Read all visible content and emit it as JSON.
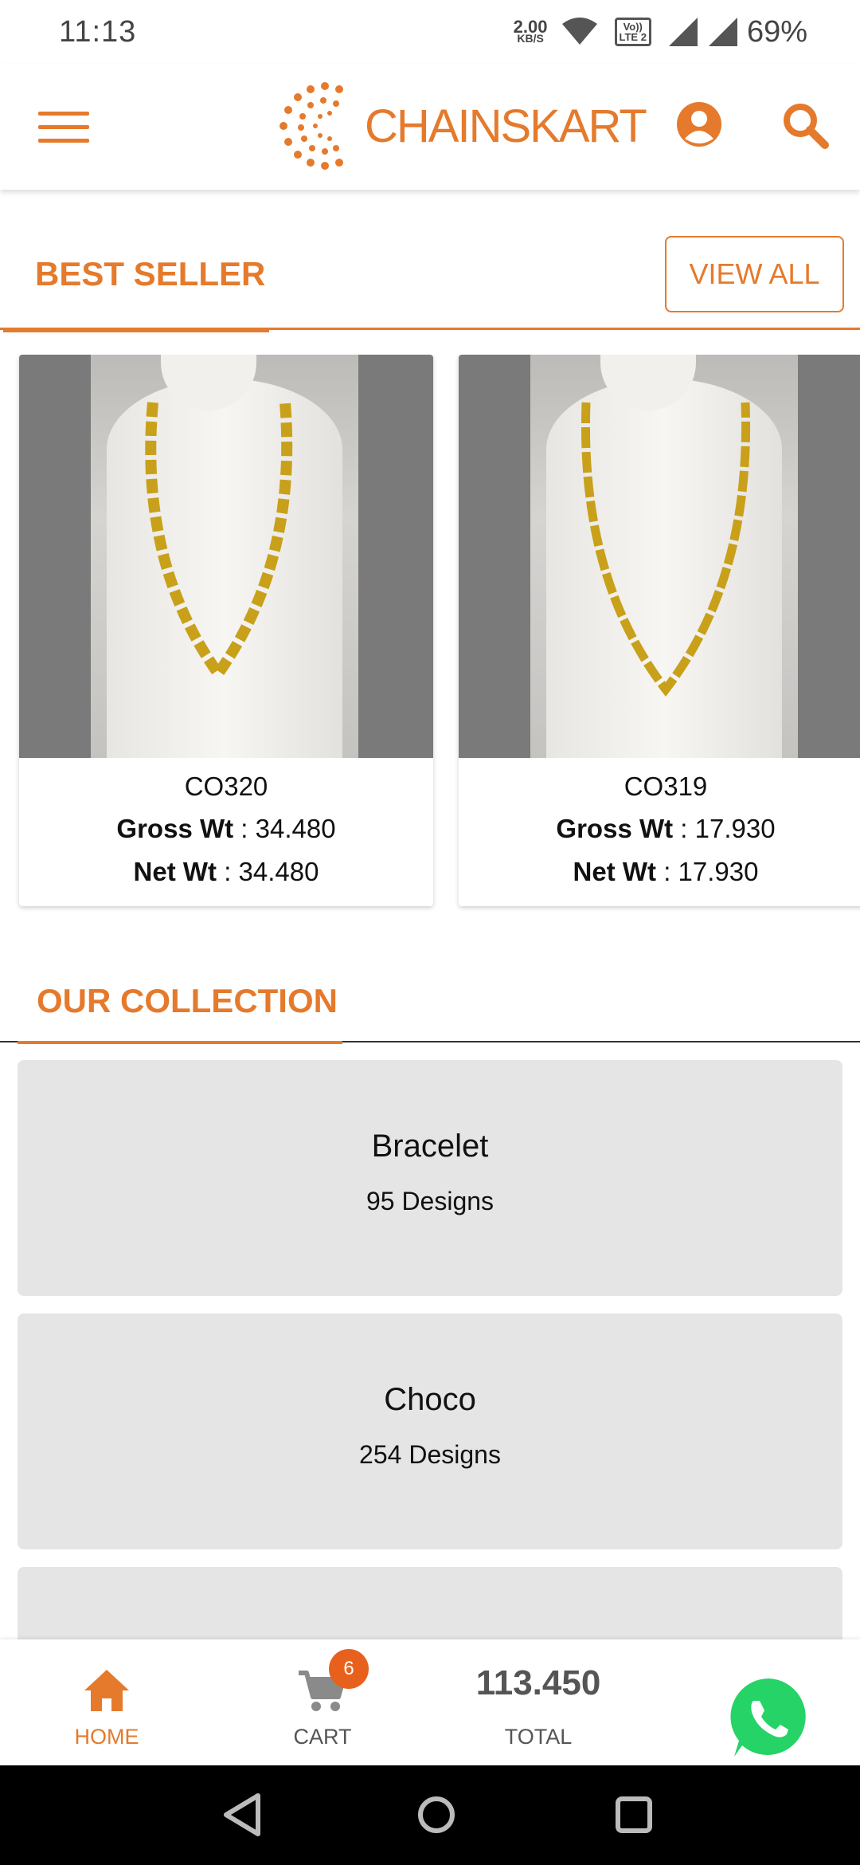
{
  "status_bar": {
    "time": "11:13",
    "net_speed_value": "2.00",
    "net_speed_unit": "KB/S",
    "volte_line1": "Vo))",
    "volte_line2": "LTE 2",
    "battery": "69%"
  },
  "header": {
    "logo_text": "CHAINSKART",
    "brand_color": "#e57a2c"
  },
  "best_seller": {
    "title": "BEST SELLER",
    "view_all_label": "VIEW ALL",
    "products": [
      {
        "code": "CO320",
        "gross_label": "Gross Wt",
        "gross_value": ": 34.480",
        "net_label": "Net Wt",
        "net_value": ": 34.480"
      },
      {
        "code": "CO319",
        "gross_label": "Gross Wt",
        "gross_value": ": 17.930",
        "net_label": "Net Wt",
        "net_value": ": 17.930"
      }
    ]
  },
  "collection": {
    "title": "OUR COLLECTION",
    "items": [
      {
        "name": "Bracelet",
        "count": "95 Designs"
      },
      {
        "name": "Choco",
        "count": "254 Designs"
      }
    ]
  },
  "bottom_nav": {
    "home_label": "HOME",
    "cart_label": "CART",
    "cart_count": "6",
    "total_value": "113.450",
    "total_label": "TOTAL"
  },
  "icons": {
    "menu": "hamburger-menu-icon",
    "profile": "user-profile-icon",
    "search": "search-icon",
    "home": "home-icon",
    "cart": "cart-icon",
    "whatsapp": "whatsapp-icon",
    "back": "back-triangle-icon",
    "home_sys": "home-circle-icon",
    "recents": "recents-square-icon"
  }
}
